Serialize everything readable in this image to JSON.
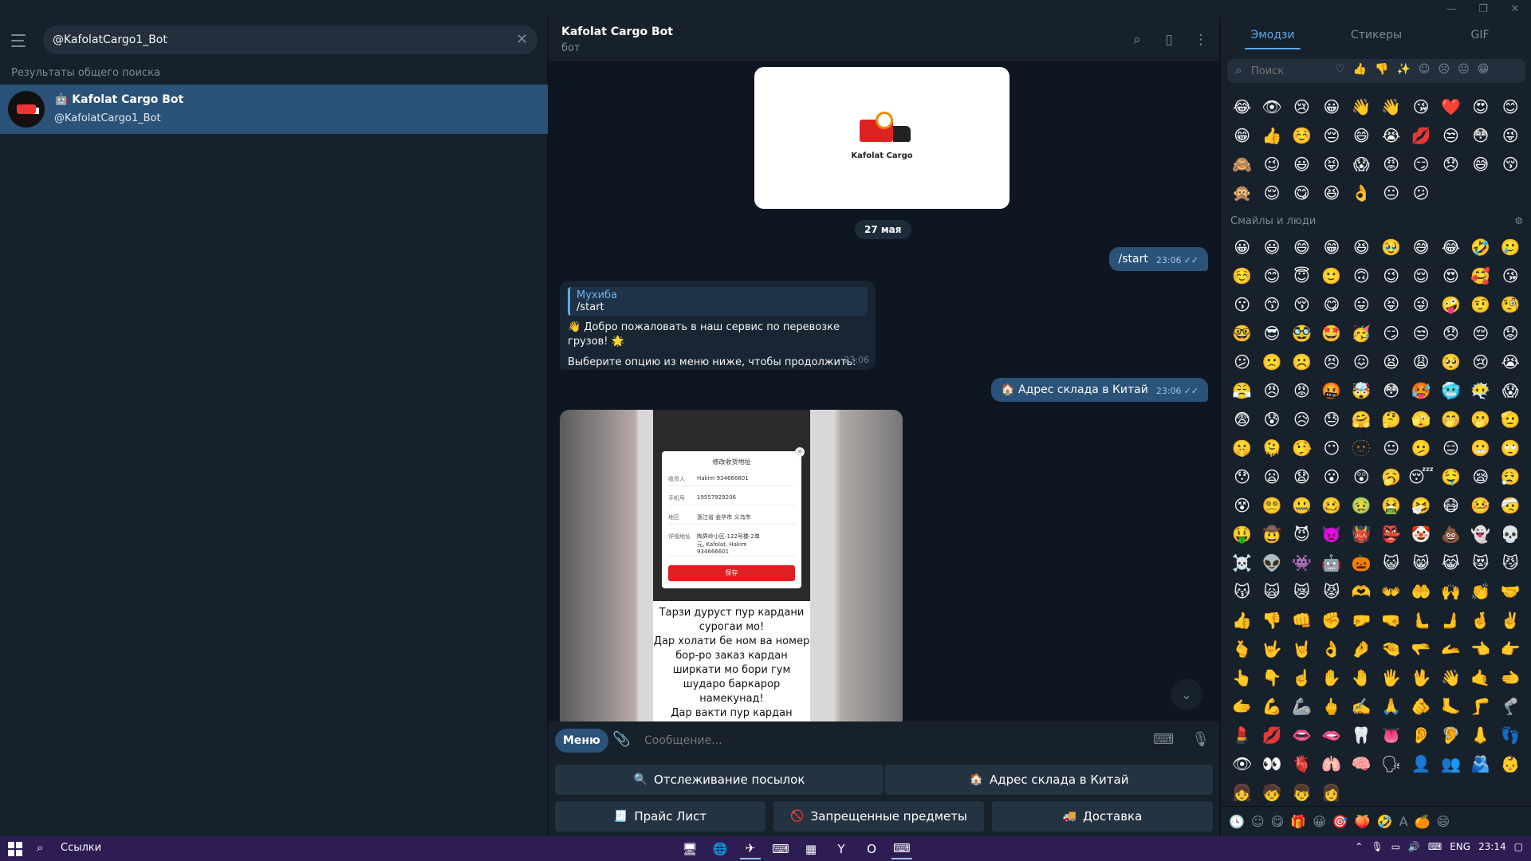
{
  "window": {
    "controls": [
      "—",
      "❐",
      "✕"
    ]
  },
  "left": {
    "search_value": "@KafolatCargo1_Bot",
    "section_label": "Результаты общего поиска",
    "result": {
      "name": "🤖 Kafolat Cargo Bot",
      "username": "@KafolatCargo1_Bot"
    }
  },
  "chat_header": {
    "title": "Kafolat Cargo Bot",
    "subtitle": "бот"
  },
  "messages": {
    "logo_brand": "Kafolat Cargo",
    "date": "27 мая",
    "out1": {
      "text": "/start",
      "time": "23:06"
    },
    "in1": {
      "reply_author": "Мухиба",
      "reply_text": "/start",
      "line1": "👋 Добро пожаловать в наш сервис по перевозке грузов! 🌟",
      "line2": "Выберите опцию из меню ниже, чтобы продолжить:",
      "time": "23:06"
    },
    "out2": {
      "text": "🏠 Адрес склада в Китай",
      "time": "23:06"
    },
    "media": {
      "dialog_title": "修改收货地址",
      "rows": [
        {
          "k": "收货人",
          "v": "Hakim 934666601"
        },
        {
          "k": "手机号",
          "v": "19557929206"
        },
        {
          "k": "地区",
          "v": "浙江省 金华市 义乌市"
        },
        {
          "k": "详细地址",
          "v": "陶界岭小区-122号楼-2单元, Kafolat, Hakim 934666601"
        }
      ],
      "save": "保存",
      "caption": "Тарзи  дуруст пур кардани\nсурогаи мо!\nДар холати бе ном ва номер\nбор-ро заказ кардан\nширкати мо бори гум\nшударо баркарор\nнамекунад!\nДар вакти пур кардан диккат\nдихед хатман ном номери"
    }
  },
  "composer": {
    "menu_label": "Меню",
    "placeholder": "Сообщение..."
  },
  "keyboard": [
    {
      "icon": "🔍",
      "label": "Отслеживание посылок"
    },
    {
      "icon": "🏠",
      "label": "Адрес склада в Китай"
    },
    {
      "icon": "🧾",
      "label": "Прайс Лист"
    },
    {
      "icon": "🚫",
      "label": "Запрещенные предметы"
    },
    {
      "icon": "🚚",
      "label": "Доставка"
    }
  ],
  "emoji_panel": {
    "tabs": [
      "Эмодзи",
      "Стикеры",
      "GIF"
    ],
    "search_placeholder": "Поиск",
    "group_label": "Смайлы и люди",
    "recent": [
      "😂",
      "👁",
      "😢",
      "😀",
      "👋",
      "👋",
      "😘",
      "❤️",
      "😍",
      "😊",
      "😁",
      "👍",
      "☺️",
      "😔",
      "😄",
      "😭",
      "💋",
      "😒",
      "😳",
      "😜",
      "🙈",
      "😉",
      "😃",
      "😝",
      "😱",
      "😡",
      "😏",
      "😞",
      "😅",
      "😚",
      "🙊",
      "😌",
      "😋",
      "😆",
      "👌",
      "😐",
      "😕"
    ],
    "people": [
      "😀",
      "😃",
      "😄",
      "😁",
      "😆",
      "🥹",
      "😅",
      "😂",
      "🤣",
      "🥲",
      "☺️",
      "😊",
      "😇",
      "🙂",
      "🙃",
      "😉",
      "😌",
      "😍",
      "🥰",
      "😘",
      "😗",
      "😙",
      "😚",
      "😋",
      "😛",
      "😝",
      "😜",
      "🤪",
      "🤨",
      "🧐",
      "🤓",
      "😎",
      "🥸",
      "🤩",
      "🥳",
      "😏",
      "😒",
      "😞",
      "😔",
      "😟",
      "😕",
      "🙁",
      "☹️",
      "😣",
      "😖",
      "😫",
      "😩",
      "🥺",
      "😢",
      "😭",
      "😤",
      "😠",
      "😡",
      "🤬",
      "🤯",
      "😳",
      "🥵",
      "🥶",
      "😶‍🌫️",
      "😱",
      "😨",
      "😰",
      "😥",
      "😓",
      "🤗",
      "🤔",
      "🫣",
      "🤭",
      "🫢",
      "🫡",
      "🤫",
      "🫠",
      "🤥",
      "😶",
      "🫥",
      "😐",
      "🫤",
      "😑",
      "😬",
      "🙄",
      "😯",
      "😦",
      "😧",
      "😮",
      "😲",
      "🥱",
      "😴",
      "🤤",
      "😪",
      "😮‍💨",
      "😵",
      "😵‍💫",
      "🤐",
      "🥴",
      "🤢",
      "🤮",
      "🤧",
      "😷",
      "🤒",
      "🤕",
      "🤑",
      "🤠",
      "😈",
      "👿",
      "👹",
      "👺",
      "🤡",
      "💩",
      "👻",
      "💀",
      "☠️",
      "👽",
      "👾",
      "🤖",
      "🎃",
      "😺",
      "😸",
      "😹",
      "😻",
      "😼",
      "😽",
      "🙀",
      "😿",
      "😾",
      "🫶",
      "👐",
      "🤲",
      "🙌",
      "👏",
      "🤝",
      "👍",
      "👎",
      "👊",
      "✊",
      "🤛",
      "🤜",
      "🫷",
      "🫸",
      "🤞",
      "✌️",
      "🫰",
      "🤟",
      "🤘",
      "👌",
      "🤌",
      "🤏",
      "🫳",
      "🫴",
      "👈",
      "👉",
      "👆",
      "👇",
      "☝️",
      "✋",
      "🤚",
      "🖐",
      "🖖",
      "👋",
      "🤙",
      "🫲",
      "🫱",
      "💪",
      "🦾",
      "🖕",
      "✍️",
      "🙏",
      "🫵",
      "🦶",
      "🦵",
      "🦿",
      "💄",
      "💋",
      "👄",
      "🫦",
      "🦷",
      "👅",
      "👂",
      "🦻",
      "👃",
      "👣",
      "👁",
      "👀",
      "🫀",
      "🫁",
      "🧠",
      "🗣",
      "👤",
      "👥",
      "🫂",
      "👶",
      "👧",
      "🧒",
      "👦",
      "👩"
    ],
    "footer": [
      "🕓",
      "☺",
      "😋",
      "🎁",
      "😀",
      "🎯",
      "🍑",
      "🤣",
      "A",
      "🍊",
      "😄"
    ]
  },
  "taskbar": {
    "search_label": "Ссылки",
    "apps": [
      "🖥",
      "🌐",
      "✈",
      "⌨",
      "▦",
      "Y",
      "O",
      "⌨"
    ],
    "tray": {
      "lang": "ENG",
      "time": "23:14"
    }
  }
}
